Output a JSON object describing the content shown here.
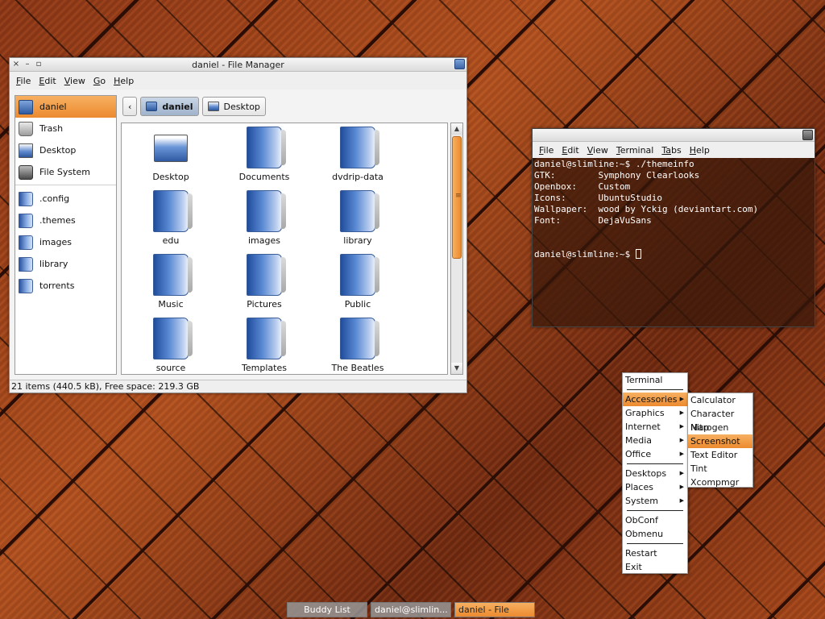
{
  "file_manager": {
    "title": "daniel - File Manager",
    "window_buttons": {
      "close": "×",
      "minimize": "–",
      "maximize": "▫"
    },
    "menu": [
      {
        "mn": "F",
        "rest": "ile"
      },
      {
        "mn": "E",
        "rest": "dit"
      },
      {
        "mn": "V",
        "rest": "iew"
      },
      {
        "mn": "G",
        "rest": "o"
      },
      {
        "mn": "H",
        "rest": "elp"
      }
    ],
    "sidebar": {
      "places": [
        "daniel",
        "Trash",
        "Desktop",
        "File System"
      ],
      "bookmarks": [
        ".config",
        ".themes",
        "images",
        "library",
        "torrents"
      ]
    },
    "path": {
      "back": "‹",
      "current": "daniel",
      "next": "Desktop"
    },
    "files": [
      "Desktop",
      "Documents",
      "dvdrip-data",
      "edu",
      "images",
      "library",
      "Music",
      "Pictures",
      "Public",
      "source",
      "Templates",
      "The Beatles"
    ],
    "status": "21 items (440.5 kB), Free space: 219.3 GB"
  },
  "terminal": {
    "menu": [
      {
        "mn": "F",
        "rest": "ile"
      },
      {
        "mn": "E",
        "rest": "dit"
      },
      {
        "mn": "V",
        "rest": "iew"
      },
      {
        "mn": "T",
        "rest": "erminal"
      },
      {
        "mn": "Ta",
        "rest": "bs",
        "pre": true
      },
      {
        "mn": "H",
        "rest": "elp"
      }
    ],
    "lines": [
      "daniel@slimline:~$ ./themeinfo",
      "",
      "GTK:        Symphony Clearlooks",
      "Openbox:    Custom",
      "Icons:      UbuntuStudio",
      "Wallpaper:  wood by Yckig (deviantart.com)",
      "Font:       DejaVuSans",
      "",
      ""
    ],
    "prompt": "daniel@slimline:~$ "
  },
  "openbox_menu": {
    "top": "Terminal",
    "categories": [
      "Accessories",
      "Graphics",
      "Internet",
      "Media",
      "Office"
    ],
    "group2": [
      "Desktops",
      "Places",
      "System"
    ],
    "group3": [
      "ObConf",
      "Obmenu"
    ],
    "group4": [
      "Restart",
      "Exit"
    ],
    "submenu": [
      "Calculator",
      "Character Map",
      "Nitrogen",
      "Screenshot",
      "Text Editor",
      "Tint",
      "Xcompmgr"
    ],
    "arrow": "▶"
  },
  "taskbar": [
    "Buddy List",
    "daniel@slimlin...",
    "daniel - File Ma..."
  ]
}
